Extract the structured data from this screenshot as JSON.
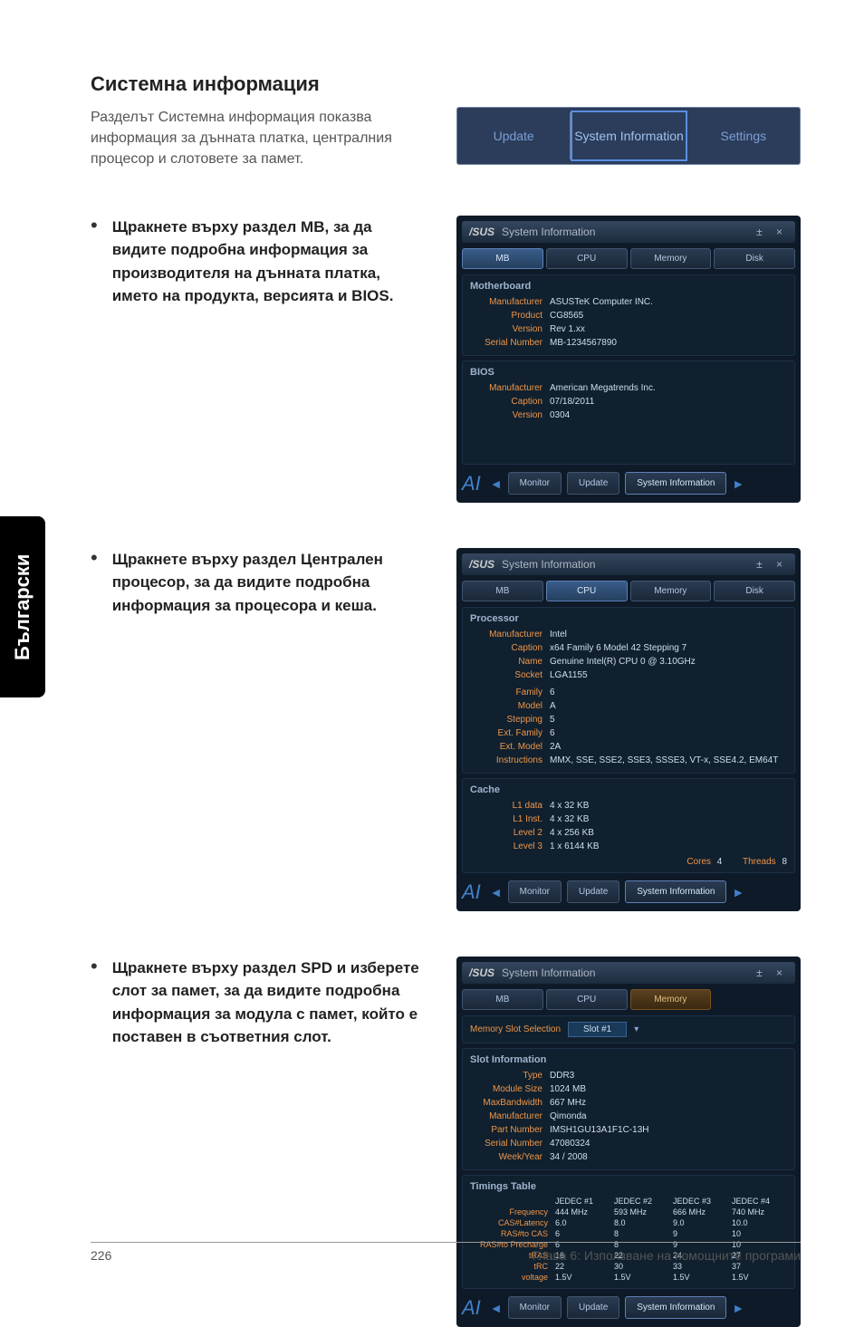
{
  "sideTab": "Български",
  "title": "Системна информация",
  "intro": "Разделът Системна информация показва информация за дънната платка, централния процесор и слотовете за памет.",
  "topTabs": {
    "update": "Update",
    "sysinfo": "System Information",
    "settings": "Settings"
  },
  "section1": {
    "text_bold_a": "Щракнете върху раздел MB, за да видите подробна информация за производителя на дънната платка, името на продукта, версията и BIOS."
  },
  "section2": {
    "text_bold_a": "Щракнете върху раздел Централен процесор, за да видите подробна информация за процесора и кеша."
  },
  "section3": {
    "text_bold_a": "Щракнете върху раздел SPD и изберете слот за памет, за да видите подробна информация за модула с памет, който е поставен в съответния слот."
  },
  "panel_header": {
    "logo": "/SUS",
    "title": "System Information",
    "controls": "±  ×"
  },
  "panel_tabs": {
    "mb": "MB",
    "cpu": "CPU",
    "memory": "Memory",
    "disk": "Disk"
  },
  "footer_btns": {
    "monitor": "Monitor",
    "update": "Update",
    "sysinfo": "System Information"
  },
  "footer_logo": "AI",
  "footer_arrow_l": "◄",
  "footer_arrow_r": "►",
  "panel1": {
    "section1_h": "Motherboard",
    "kv": [
      {
        "k": "Manufacturer",
        "v": "ASUSTeK Computer INC."
      },
      {
        "k": "Product",
        "v": "CG8565"
      },
      {
        "k": "Version",
        "v": "Rev 1.xx"
      },
      {
        "k": "Serial Number",
        "v": "MB-1234567890"
      }
    ],
    "section2_h": "BIOS",
    "kv2": [
      {
        "k": "Manufacturer",
        "v": "American Megatrends Inc."
      },
      {
        "k": "Caption",
        "v": "07/18/2011"
      },
      {
        "k": "Version",
        "v": "0304"
      }
    ]
  },
  "panel2": {
    "section1_h": "Processor",
    "kv": [
      {
        "k": "Manufacturer",
        "v": "Intel"
      },
      {
        "k": "Caption",
        "v": "x64 Family 6 Model 42 Stepping 7"
      },
      {
        "k": "Name",
        "v": "Genuine Intel(R) CPU 0 @ 3.10GHz"
      },
      {
        "k": "Socket",
        "v": "LGA1155"
      }
    ],
    "kv1b": [
      {
        "k": "Family",
        "v": "6"
      },
      {
        "k": "Model",
        "v": "A"
      },
      {
        "k": "Stepping",
        "v": "5"
      },
      {
        "k": "Ext. Family",
        "v": "6"
      },
      {
        "k": "Ext. Model",
        "v": "2A"
      },
      {
        "k": "Instructions",
        "v": "MMX, SSE, SSE2, SSE3, SSSE3, VT-x, SSE4.2, EM64T"
      }
    ],
    "section2_h": "Cache",
    "kv2": [
      {
        "k": "L1 data",
        "v": "4 x 32 KB"
      },
      {
        "k": "L1 Inst.",
        "v": "4 x 32 KB"
      },
      {
        "k": "Level 2",
        "v": "4 x 256 KB"
      },
      {
        "k": "Level 3",
        "v": "1 x 6144 KB"
      }
    ],
    "cores_label": "Cores",
    "cores": "4",
    "threads_label": "Threads",
    "threads": "8"
  },
  "panel3": {
    "memsel_label": "Memory Slot Selection",
    "memsel_value": "Slot #1",
    "section1_h": "Slot Information",
    "kv": [
      {
        "k": "Type",
        "v": "DDR3"
      },
      {
        "k": "Module Size",
        "v": "1024 MB"
      },
      {
        "k": "MaxBandwidth",
        "v": "667 MHz"
      },
      {
        "k": "Manufacturer",
        "v": "Qimonda"
      },
      {
        "k": "Part Number",
        "v": "IMSH1GU13A1F1C-13H"
      },
      {
        "k": "Serial Number",
        "v": "47080324"
      },
      {
        "k": "Week/Year",
        "v": "34 / 2008"
      }
    ],
    "section2_h": "Timings Table",
    "cols": [
      "JEDEC #1",
      "JEDEC #2",
      "JEDEC #3",
      "JEDEC #4"
    ],
    "rows": [
      {
        "k": "Frequency",
        "v": [
          "444 MHz",
          "593 MHz",
          "666 MHz",
          "740 MHz"
        ]
      },
      {
        "k": "CAS#Latency",
        "v": [
          "6.0",
          "8.0",
          "9.0",
          "10.0"
        ]
      },
      {
        "k": "RAS#to CAS",
        "v": [
          "6",
          "8",
          "9",
          "10"
        ]
      },
      {
        "k": "RAS#to Precharge",
        "v": [
          "6",
          "8",
          "9",
          "10"
        ]
      },
      {
        "k": "tRAS",
        "v": [
          "16",
          "22",
          "24",
          "27"
        ]
      },
      {
        "k": "tRC",
        "v": [
          "22",
          "30",
          "33",
          "37"
        ]
      },
      {
        "k": "voltage",
        "v": [
          "1.5V",
          "1.5V",
          "1.5V",
          "1.5V"
        ]
      }
    ]
  },
  "pageNumber": "226",
  "footerRight": "Глава 6: Използване на помощните програми"
}
